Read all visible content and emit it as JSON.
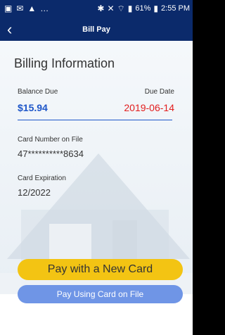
{
  "status": {
    "time": "2:55 PM",
    "battery": "61%"
  },
  "header": {
    "title": "Bill Pay",
    "back_icon": "chevron-left-icon"
  },
  "billing": {
    "heading": "Billing Information",
    "balance_label": "Balance Due",
    "balance_value": "$15.94",
    "due_label": "Due Date",
    "due_value": "2019-06-14",
    "card_label": "Card Number on File",
    "card_value": "47**********8634",
    "exp_label": "Card Expiration",
    "exp_value": "12/2022"
  },
  "buttons": {
    "new_card": "Pay with a New Card",
    "file_card": "Pay Using Card on File"
  },
  "colors": {
    "header_bg": "#0b2a6b",
    "primary_btn": "#f3c413",
    "secondary_btn": "#6f95e6",
    "accent": "#1e56c9",
    "due_date": "#e21d1d"
  }
}
